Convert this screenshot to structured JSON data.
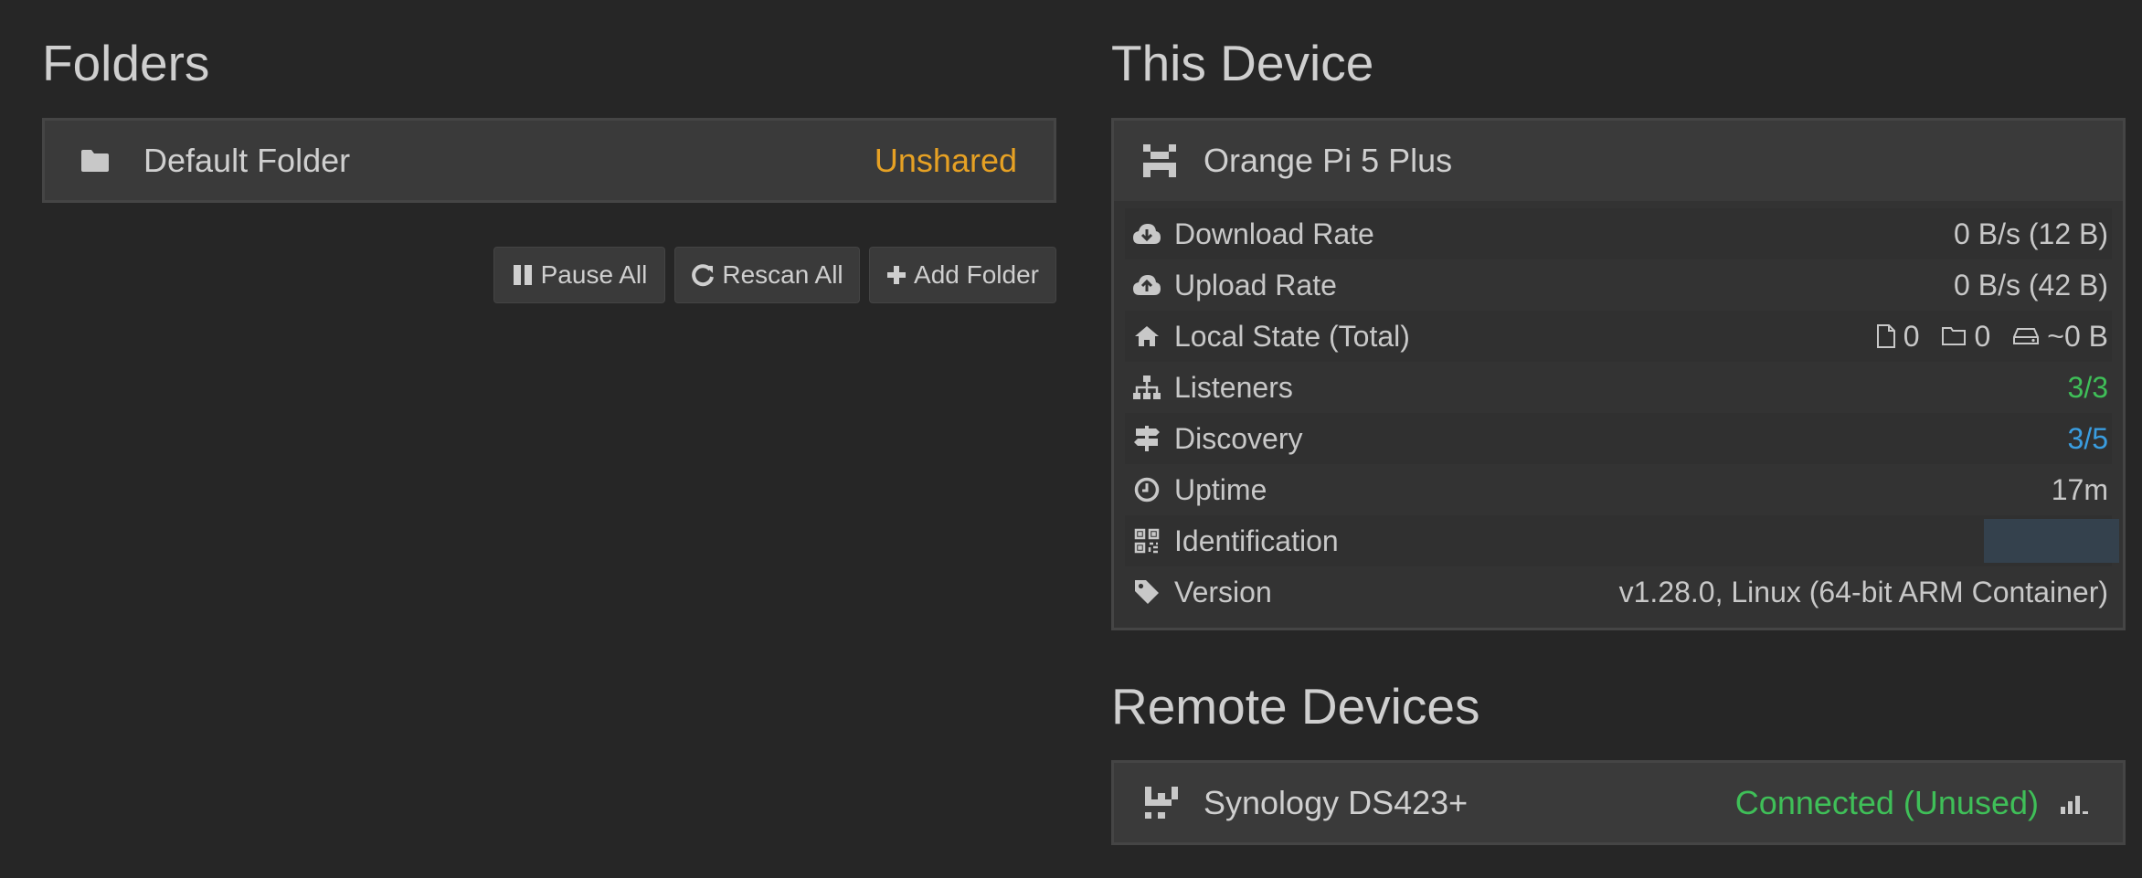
{
  "folders": {
    "heading": "Folders",
    "items": [
      {
        "name": "Default Folder",
        "status": "Unshared"
      }
    ],
    "buttons": {
      "pause_all": "Pause All",
      "rescan_all": "Rescan All",
      "add_folder": "Add Folder"
    }
  },
  "this_device": {
    "heading": "This Device",
    "name": "Orange Pi 5 Plus",
    "rows": [
      {
        "label": "Download Rate",
        "value": "0 B/s (12 B)",
        "icon": "cloud-download-icon"
      },
      {
        "label": "Upload Rate",
        "value": "0 B/s (42 B)",
        "icon": "cloud-upload-icon"
      },
      {
        "label": "Local State (Total)",
        "icon": "home-icon",
        "files": "0",
        "dirs": "0",
        "size": "~0 B"
      },
      {
        "label": "Listeners",
        "value": "3/3",
        "icon": "sitemap-icon"
      },
      {
        "label": "Discovery",
        "value": "3/5",
        "icon": "signpost-icon"
      },
      {
        "label": "Uptime",
        "value": "17m",
        "icon": "clock-icon"
      },
      {
        "label": "Identification",
        "icon": "qrcode-icon"
      },
      {
        "label": "Version",
        "value": "v1.28.0, Linux (64-bit ARM Container)",
        "icon": "tag-icon"
      }
    ]
  },
  "remote_devices": {
    "heading": "Remote Devices",
    "items": [
      {
        "name": "Synology DS423+",
        "status": "Connected (Unused)"
      }
    ]
  },
  "colors": {
    "background": "#262626",
    "panel": "#333333",
    "unshared": "#e6a124",
    "connected": "#3fbf58",
    "discovery": "#3a9de0"
  }
}
